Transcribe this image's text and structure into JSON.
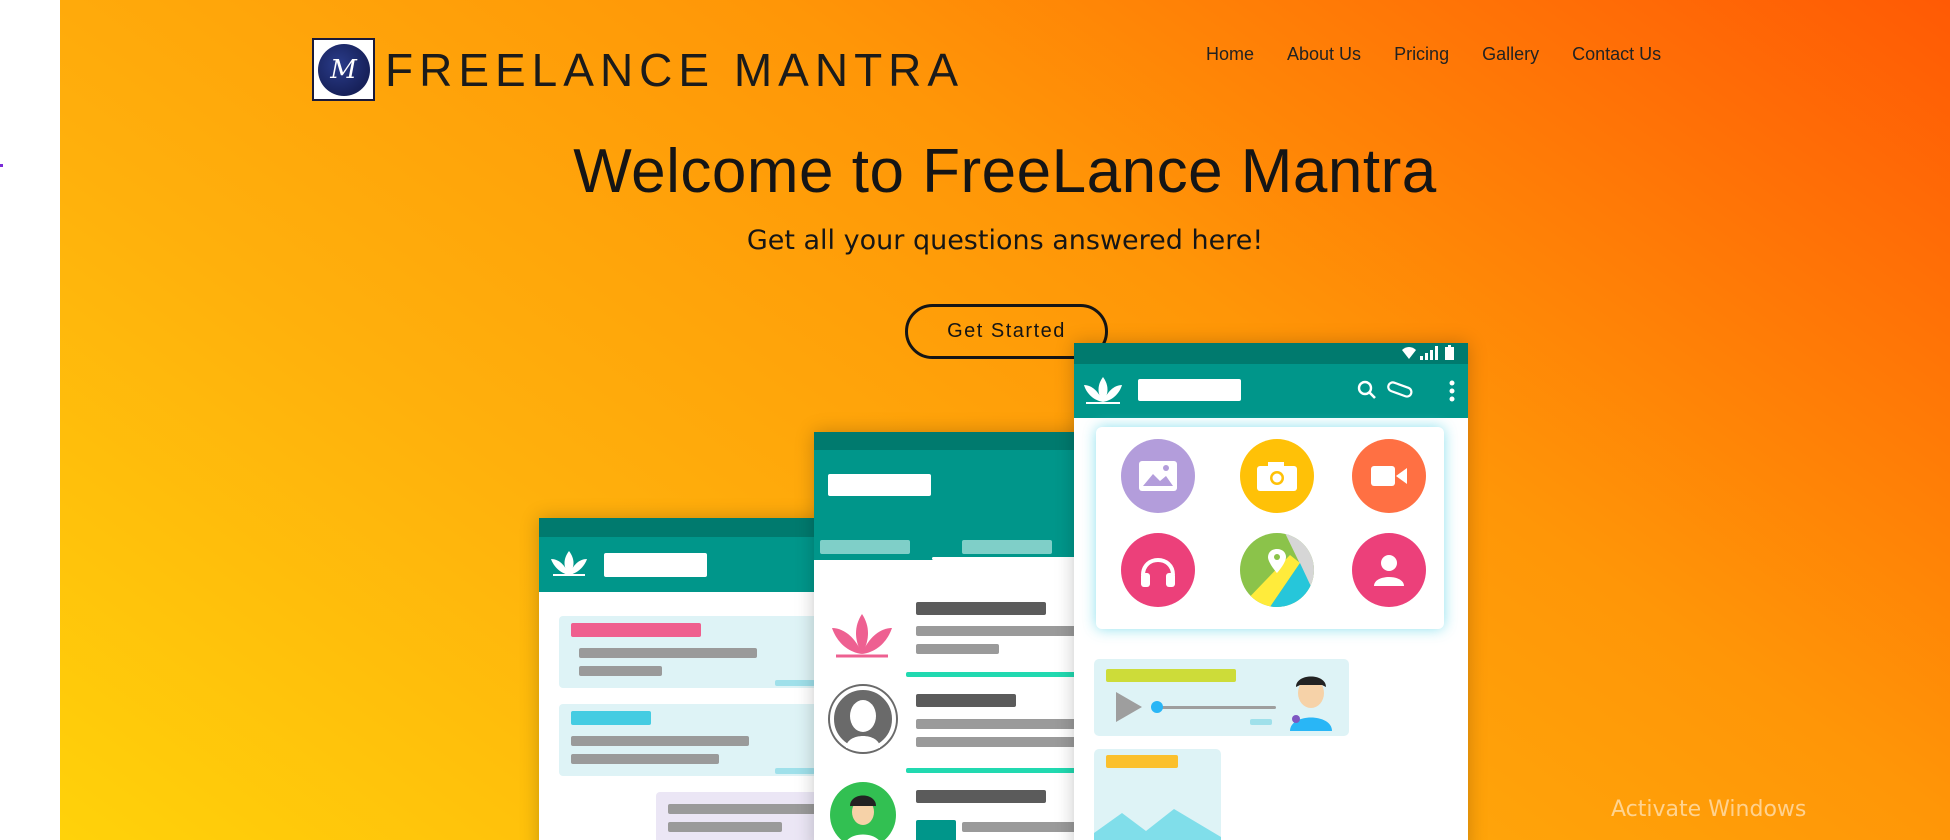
{
  "brand": {
    "name": "FREELANCE MANTRA",
    "logo_letter": "M"
  },
  "nav": {
    "items": [
      "Home",
      "About Us",
      "Pricing",
      "Gallery",
      "Contact Us"
    ]
  },
  "hero": {
    "title": "Welcome to FreeLance Mantra",
    "subtitle": "Get all your questions answered here!",
    "cta_label": "Get Started"
  },
  "illustration": {
    "icons": [
      "lotus-icon",
      "search-icon",
      "paperclip-icon",
      "more-vert-icon",
      "image-icon",
      "camera-icon",
      "video-icon",
      "headphones-icon",
      "location-icon",
      "contact-icon",
      "play-icon",
      "wifi-icon",
      "signal-icon",
      "battery-icon"
    ]
  },
  "colors": {
    "gradient_start": "#ffd20a",
    "gradient_end": "#ff5a05",
    "app_teal": "#00968a",
    "app_teal_dark": "#007a6e"
  },
  "watermark": "Activate Windows"
}
